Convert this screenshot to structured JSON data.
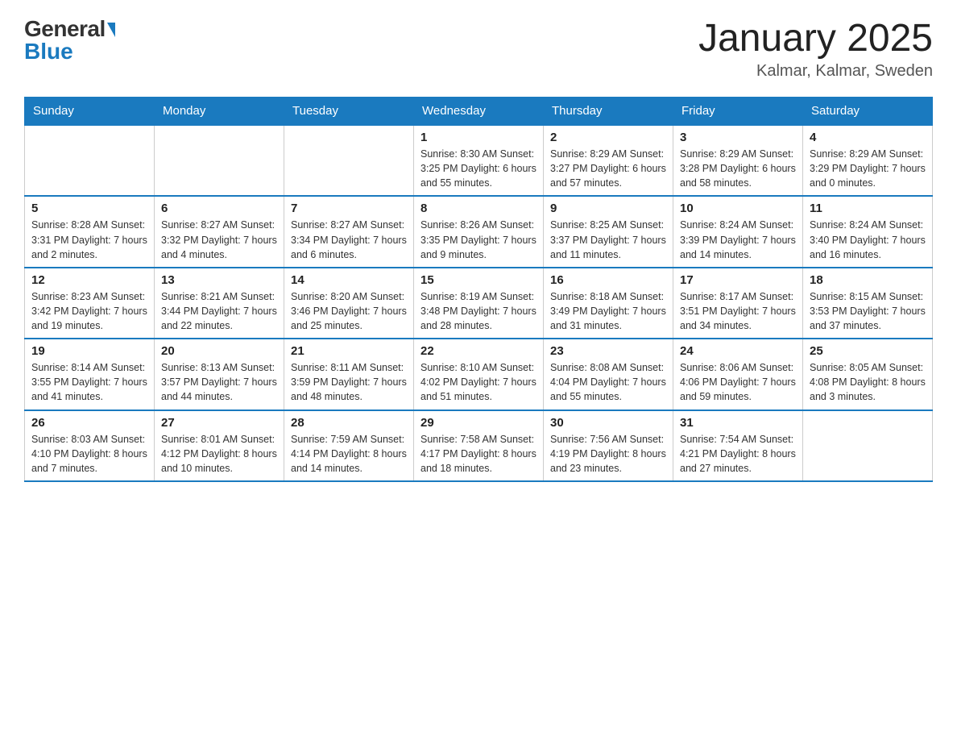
{
  "header": {
    "logo_general": "General",
    "logo_blue": "Blue",
    "month_title": "January 2025",
    "location": "Kalmar, Kalmar, Sweden"
  },
  "days_of_week": [
    "Sunday",
    "Monday",
    "Tuesday",
    "Wednesday",
    "Thursday",
    "Friday",
    "Saturday"
  ],
  "weeks": [
    [
      {
        "day": "",
        "info": ""
      },
      {
        "day": "",
        "info": ""
      },
      {
        "day": "",
        "info": ""
      },
      {
        "day": "1",
        "info": "Sunrise: 8:30 AM\nSunset: 3:25 PM\nDaylight: 6 hours\nand 55 minutes."
      },
      {
        "day": "2",
        "info": "Sunrise: 8:29 AM\nSunset: 3:27 PM\nDaylight: 6 hours\nand 57 minutes."
      },
      {
        "day": "3",
        "info": "Sunrise: 8:29 AM\nSunset: 3:28 PM\nDaylight: 6 hours\nand 58 minutes."
      },
      {
        "day": "4",
        "info": "Sunrise: 8:29 AM\nSunset: 3:29 PM\nDaylight: 7 hours\nand 0 minutes."
      }
    ],
    [
      {
        "day": "5",
        "info": "Sunrise: 8:28 AM\nSunset: 3:31 PM\nDaylight: 7 hours\nand 2 minutes."
      },
      {
        "day": "6",
        "info": "Sunrise: 8:27 AM\nSunset: 3:32 PM\nDaylight: 7 hours\nand 4 minutes."
      },
      {
        "day": "7",
        "info": "Sunrise: 8:27 AM\nSunset: 3:34 PM\nDaylight: 7 hours\nand 6 minutes."
      },
      {
        "day": "8",
        "info": "Sunrise: 8:26 AM\nSunset: 3:35 PM\nDaylight: 7 hours\nand 9 minutes."
      },
      {
        "day": "9",
        "info": "Sunrise: 8:25 AM\nSunset: 3:37 PM\nDaylight: 7 hours\nand 11 minutes."
      },
      {
        "day": "10",
        "info": "Sunrise: 8:24 AM\nSunset: 3:39 PM\nDaylight: 7 hours\nand 14 minutes."
      },
      {
        "day": "11",
        "info": "Sunrise: 8:24 AM\nSunset: 3:40 PM\nDaylight: 7 hours\nand 16 minutes."
      }
    ],
    [
      {
        "day": "12",
        "info": "Sunrise: 8:23 AM\nSunset: 3:42 PM\nDaylight: 7 hours\nand 19 minutes."
      },
      {
        "day": "13",
        "info": "Sunrise: 8:21 AM\nSunset: 3:44 PM\nDaylight: 7 hours\nand 22 minutes."
      },
      {
        "day": "14",
        "info": "Sunrise: 8:20 AM\nSunset: 3:46 PM\nDaylight: 7 hours\nand 25 minutes."
      },
      {
        "day": "15",
        "info": "Sunrise: 8:19 AM\nSunset: 3:48 PM\nDaylight: 7 hours\nand 28 minutes."
      },
      {
        "day": "16",
        "info": "Sunrise: 8:18 AM\nSunset: 3:49 PM\nDaylight: 7 hours\nand 31 minutes."
      },
      {
        "day": "17",
        "info": "Sunrise: 8:17 AM\nSunset: 3:51 PM\nDaylight: 7 hours\nand 34 minutes."
      },
      {
        "day": "18",
        "info": "Sunrise: 8:15 AM\nSunset: 3:53 PM\nDaylight: 7 hours\nand 37 minutes."
      }
    ],
    [
      {
        "day": "19",
        "info": "Sunrise: 8:14 AM\nSunset: 3:55 PM\nDaylight: 7 hours\nand 41 minutes."
      },
      {
        "day": "20",
        "info": "Sunrise: 8:13 AM\nSunset: 3:57 PM\nDaylight: 7 hours\nand 44 minutes."
      },
      {
        "day": "21",
        "info": "Sunrise: 8:11 AM\nSunset: 3:59 PM\nDaylight: 7 hours\nand 48 minutes."
      },
      {
        "day": "22",
        "info": "Sunrise: 8:10 AM\nSunset: 4:02 PM\nDaylight: 7 hours\nand 51 minutes."
      },
      {
        "day": "23",
        "info": "Sunrise: 8:08 AM\nSunset: 4:04 PM\nDaylight: 7 hours\nand 55 minutes."
      },
      {
        "day": "24",
        "info": "Sunrise: 8:06 AM\nSunset: 4:06 PM\nDaylight: 7 hours\nand 59 minutes."
      },
      {
        "day": "25",
        "info": "Sunrise: 8:05 AM\nSunset: 4:08 PM\nDaylight: 8 hours\nand 3 minutes."
      }
    ],
    [
      {
        "day": "26",
        "info": "Sunrise: 8:03 AM\nSunset: 4:10 PM\nDaylight: 8 hours\nand 7 minutes."
      },
      {
        "day": "27",
        "info": "Sunrise: 8:01 AM\nSunset: 4:12 PM\nDaylight: 8 hours\nand 10 minutes."
      },
      {
        "day": "28",
        "info": "Sunrise: 7:59 AM\nSunset: 4:14 PM\nDaylight: 8 hours\nand 14 minutes."
      },
      {
        "day": "29",
        "info": "Sunrise: 7:58 AM\nSunset: 4:17 PM\nDaylight: 8 hours\nand 18 minutes."
      },
      {
        "day": "30",
        "info": "Sunrise: 7:56 AM\nSunset: 4:19 PM\nDaylight: 8 hours\nand 23 minutes."
      },
      {
        "day": "31",
        "info": "Sunrise: 7:54 AM\nSunset: 4:21 PM\nDaylight: 8 hours\nand 27 minutes."
      },
      {
        "day": "",
        "info": ""
      }
    ]
  ]
}
